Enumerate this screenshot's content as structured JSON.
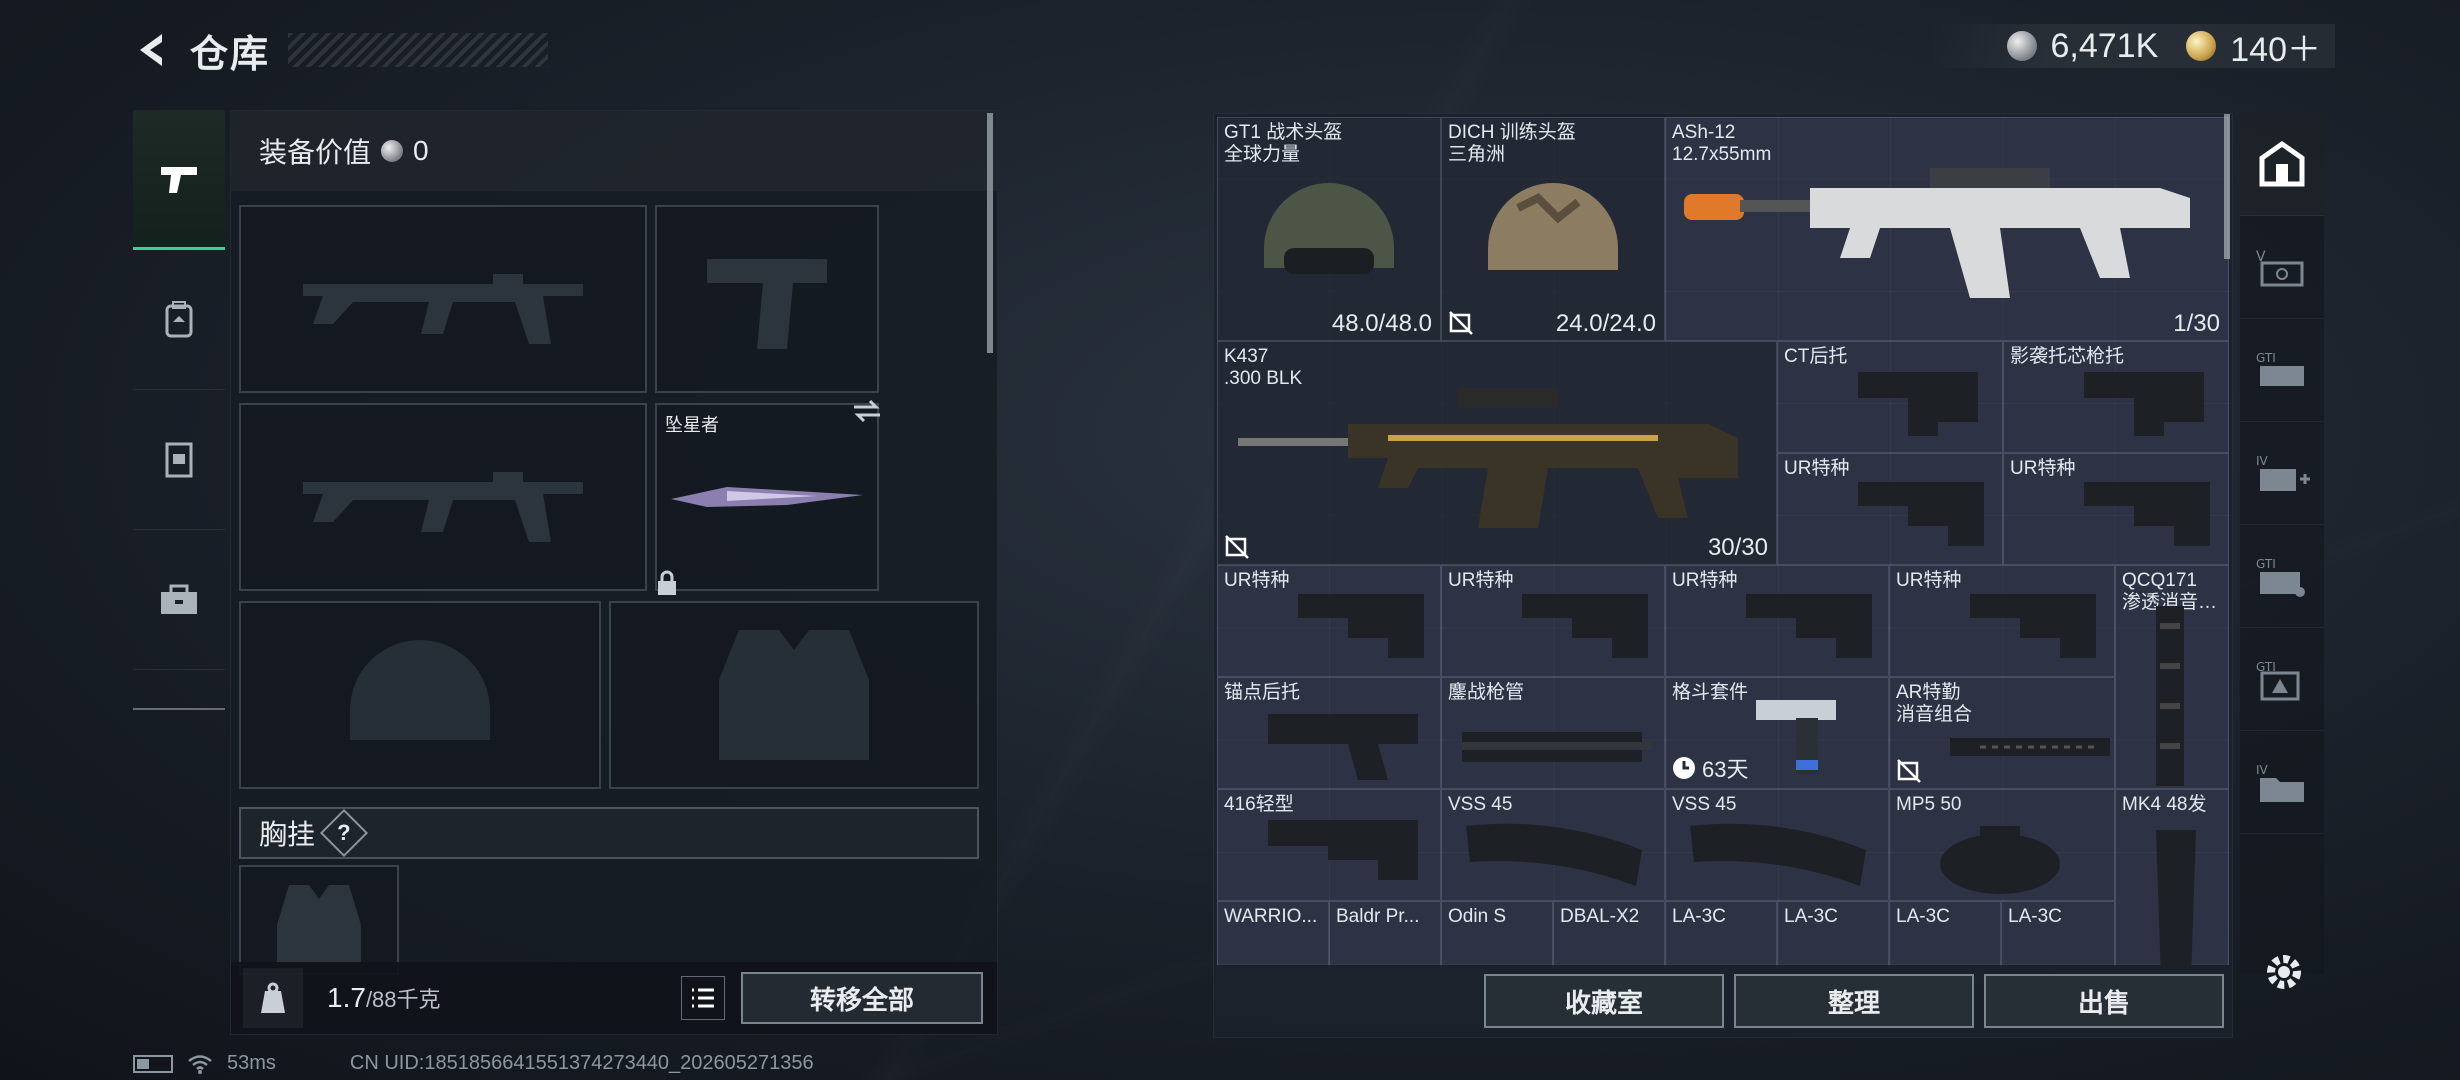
{
  "header": {
    "title": "仓库",
    "silver": "6,471K",
    "gold": "140＋",
    "version": ""
  },
  "side_nav": [
    "weapons-tab-icon",
    "backpack-tab-icon",
    "armor-tab-icon",
    "toolbox-tab-icon"
  ],
  "equipment": {
    "value_label": "装备价值",
    "value": "0",
    "melee_name": "坠星者",
    "chest_rig_label": "胸挂",
    "help": "?",
    "weight": "1.7",
    "weight_max": "/88千克",
    "transfer_all": "转移全部"
  },
  "stash": {
    "items": [
      {
        "name": "GT1 战术头盔",
        "sub": "全球力量",
        "count": "48.0/48.0"
      },
      {
        "name": "DICH 训练头盔",
        "sub": "三角洲",
        "count": "24.0/24.0"
      },
      {
        "name": "ASh-12",
        "sub": "12.7x55mm",
        "count": "1/30"
      },
      {
        "name": "K437",
        "sub": ".300 BLK",
        "count": "30/30"
      },
      {
        "name": "CT后托"
      },
      {
        "name": "影袭托芯枪托"
      },
      {
        "name": "UR特种"
      },
      {
        "name": "UR特种"
      },
      {
        "name": "UR特种"
      },
      {
        "name": "UR特种"
      },
      {
        "name": "UR特种"
      },
      {
        "name": "UR特种"
      },
      {
        "name": "QCQ171",
        "sub": "渗透消音…"
      },
      {
        "name": "锚点后托"
      },
      {
        "name": "鏖战枪管"
      },
      {
        "name": "格斗套件",
        "timer": "63天"
      },
      {
        "name": "AR特勤",
        "sub": "消音组合"
      },
      {
        "name": "416轻型"
      },
      {
        "name": "VSS 45"
      },
      {
        "name": "VSS 45"
      },
      {
        "name": "MP5 50"
      },
      {
        "name": "MK4 48发"
      },
      {
        "name": "WARRIO..."
      },
      {
        "name": "Baldr Pr..."
      },
      {
        "name": "Odin S"
      },
      {
        "name": "DBAL-X2"
      },
      {
        "name": "LA-3C"
      },
      {
        "name": "LA-3C"
      },
      {
        "name": "LA-3C"
      },
      {
        "name": "LA-3C"
      }
    ],
    "buttons": {
      "collection": "收藏室",
      "organize": "整理",
      "sell": "出售"
    }
  },
  "category_tabs": [
    "stash-home-icon",
    "v-storage-icon",
    "gt1-storage-icon",
    "iv-medical-icon",
    "gt1-case-icon",
    "gt1-armor-icon",
    "iv-folder-icon"
  ],
  "status": {
    "ping": "53ms",
    "uid": "CN UID:1851856641551374273440_202605271356"
  },
  "colors": {
    "accent": "#35d39a",
    "panel": "#1c222c",
    "item_bg": "#343a52"
  }
}
